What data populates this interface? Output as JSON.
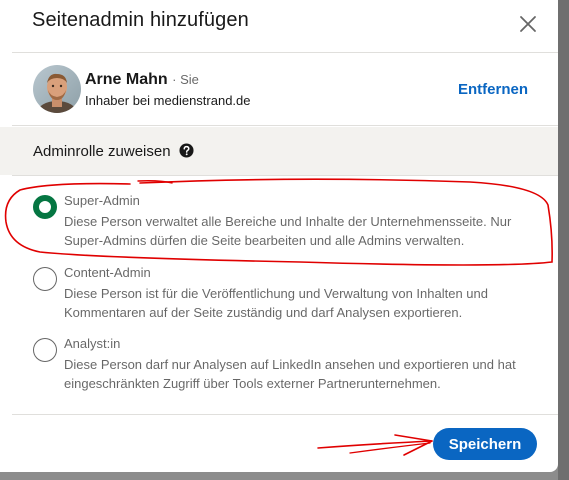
{
  "modal": {
    "title": "Seitenadmin hinzufügen",
    "close_icon": "close-icon"
  },
  "user": {
    "name": "Arne Mahn",
    "you_label": "· Sie",
    "headline": "Inhaber bei medienstrand.de",
    "remove_label": "Entfernen"
  },
  "section": {
    "heading": "Adminrolle zuweisen",
    "help_icon": "help-icon"
  },
  "roles": [
    {
      "title": "Super-Admin",
      "description": "Diese Person verwaltet alle Bereiche und Inhalte der Unternehmensseite. Nur Super-Admins dürfen die Seite bearbeiten und alle Admins verwalten.",
      "selected": true
    },
    {
      "title": "Content-Admin",
      "description": "Diese Person ist für die Veröffentlichung und Verwaltung von Inhalten und Kommentaren auf der Seite zuständig und darf Analysen exportieren.",
      "selected": false
    },
    {
      "title": "Analyst:in",
      "description": "Diese Person darf nur Analysen auf LinkedIn ansehen und exportieren und hat eingeschränkten Zugriff über Tools externer Partnerunternehmen.",
      "selected": false
    }
  ],
  "footer": {
    "save_label": "Speichern"
  },
  "colors": {
    "accent_blue": "#0a66c2",
    "selected_green": "#057642",
    "annotation_red": "#e00000"
  }
}
